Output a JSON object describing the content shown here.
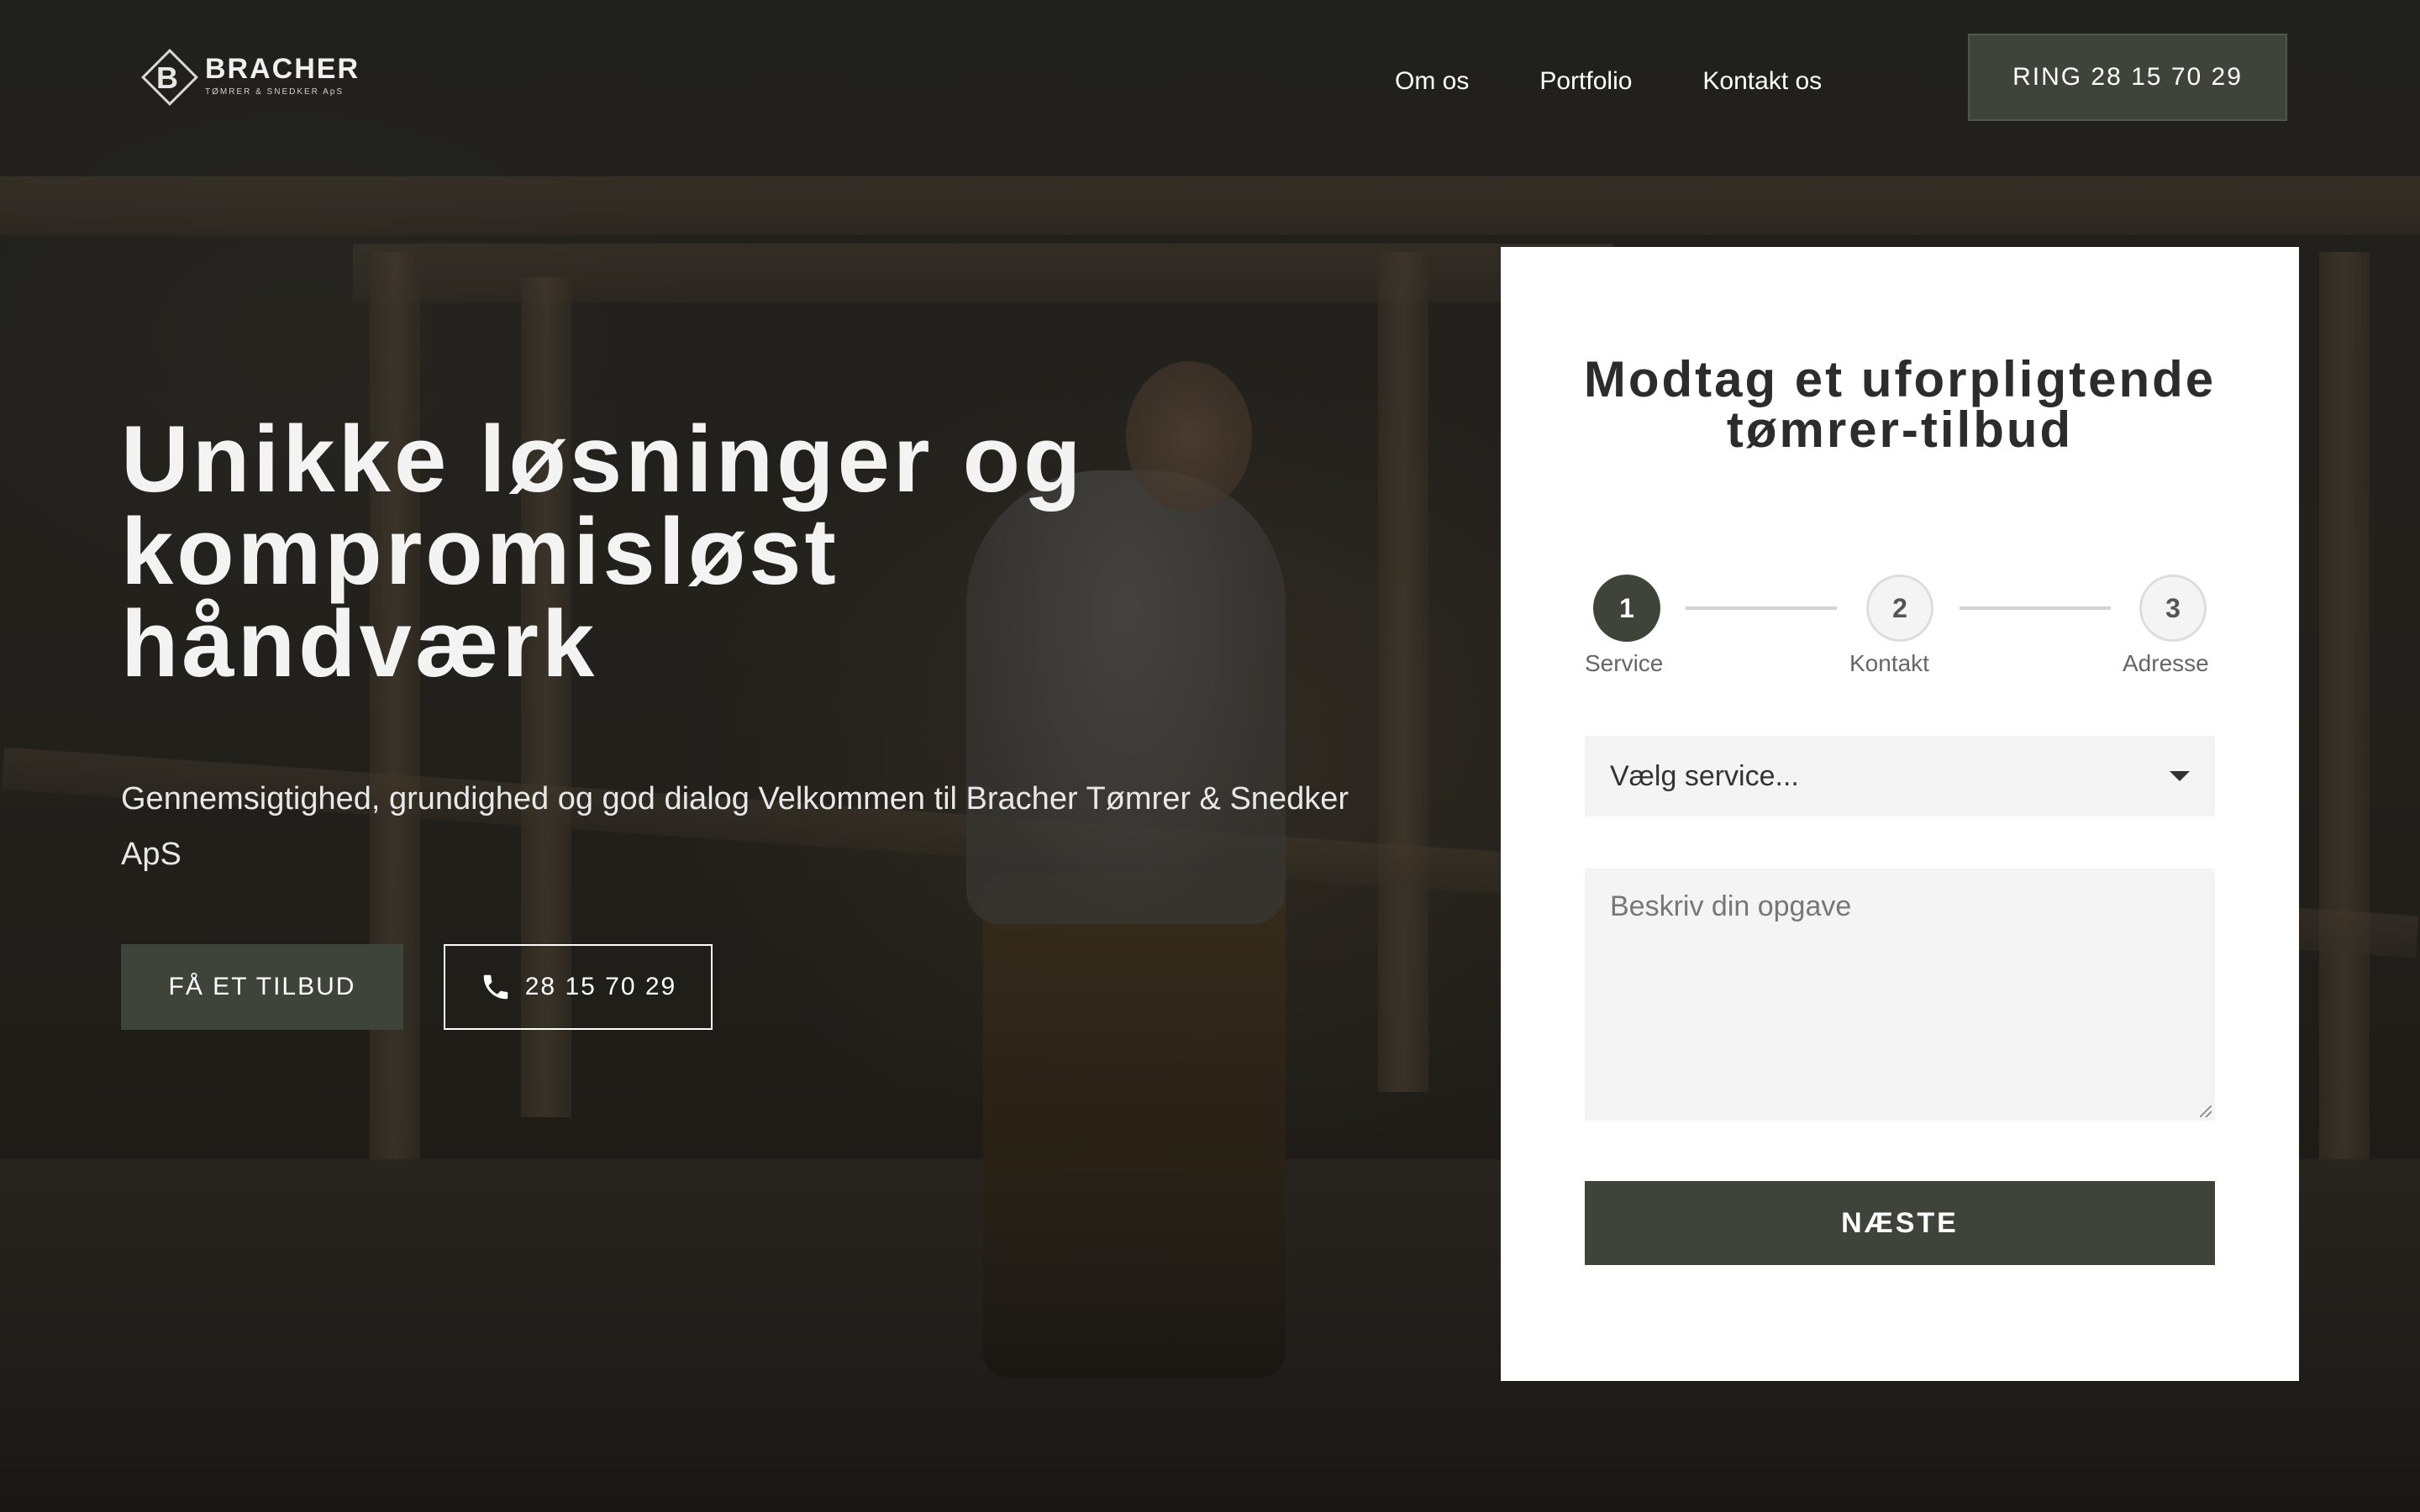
{
  "brand": {
    "name": "BRACHER",
    "tagline": "TØMRER & SNEDKER ApS",
    "logo_letter": "B"
  },
  "nav": {
    "items": [
      {
        "label": "Om os"
      },
      {
        "label": "Portfolio"
      },
      {
        "label": "Kontakt os"
      }
    ],
    "cta_label": "RING 28 15 70 29"
  },
  "hero": {
    "title": "Unikke løsninger og kompromisløst håndværk",
    "subtitle": "Gennemsigtighed, grundighed og god dialog Velkommen til Bracher Tømrer & Snedker ApS",
    "offer_button": "FÅ ET TILBUD",
    "phone_button": "28 15 70 29",
    "phone_icon": "phone-icon"
  },
  "form": {
    "title": "Modtag et uforpligtende tømrer-tilbud",
    "steps": [
      {
        "number": "1",
        "label": "Service",
        "active": true
      },
      {
        "number": "2",
        "label": "Kontakt",
        "active": false
      },
      {
        "number": "3",
        "label": "Adresse",
        "active": false
      }
    ],
    "service_select": "Vælg service...",
    "task_placeholder": "Beskriv din opgave",
    "next_button": "NÆSTE"
  },
  "colors": {
    "accent": "#3e443a",
    "card_bg": "#ffffff",
    "field_bg": "#f4f4f4"
  }
}
